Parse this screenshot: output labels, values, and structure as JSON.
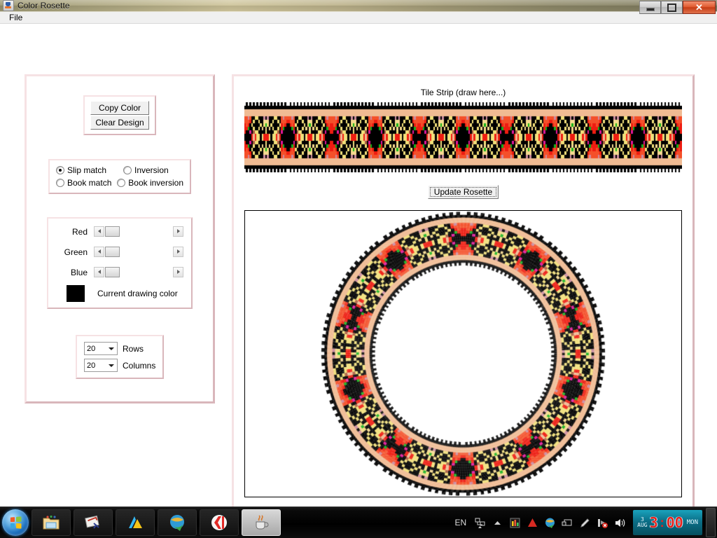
{
  "window": {
    "title": "Color Rosette",
    "icon": "java-coffee-cup-icon",
    "buttons": {
      "minimize": "–",
      "maximize": "❐",
      "close": "✕"
    }
  },
  "menubar": {
    "items": [
      {
        "label": "File"
      }
    ]
  },
  "left_panel": {
    "buttons": [
      {
        "label": "Copy Color",
        "name": "copy-color-button"
      },
      {
        "label": "Clear Design",
        "name": "clear-design-button"
      }
    ],
    "match_modes": [
      {
        "label": "Slip match",
        "selected": true
      },
      {
        "label": "Inversion",
        "selected": false
      },
      {
        "label": "Book match",
        "selected": false
      },
      {
        "label": "Book inversion",
        "selected": false
      }
    ],
    "color_sliders": [
      {
        "label": "Red",
        "value": 0
      },
      {
        "label": "Green",
        "value": 0
      },
      {
        "label": "Blue",
        "value": 0
      }
    ],
    "current_color": {
      "label": "Current drawing color",
      "hex": "#000000"
    },
    "grid": [
      {
        "value": "20",
        "label": "Rows"
      },
      {
        "value": "20",
        "label": "Columns"
      }
    ]
  },
  "right_panel": {
    "strip_title": "Tile Strip (draw here...)",
    "update_button": "Update Rosette"
  },
  "artwork": {
    "palette": {
      "black": "#000000",
      "red": "#ee1c11",
      "orange_red": "#f4502a",
      "yellow": "#f2e07a",
      "cream": "#f5d98f",
      "peach": "#f0bb93",
      "brown": "#a85c40",
      "pink": "#cc8ca0",
      "magenta": "#e0189a",
      "green": "#13b11d",
      "white": "#ffffff"
    },
    "rows": 20,
    "columns": 20,
    "strip_repeats": 5
  },
  "taskbar": {
    "start": "windows-start-orb",
    "items": [
      {
        "name": "taskbar-item-explorer",
        "icon": "folder-icon",
        "active": false
      },
      {
        "name": "taskbar-item-app2",
        "icon": "package-icon",
        "active": false
      },
      {
        "name": "taskbar-item-aimp",
        "icon": "triangle-icon",
        "active": false
      },
      {
        "name": "taskbar-item-idm",
        "icon": "globe-arrow-icon",
        "active": false
      },
      {
        "name": "taskbar-item-yandex",
        "icon": "yandex-icon",
        "active": false
      },
      {
        "name": "taskbar-item-java",
        "icon": "java-coffee-cup-icon",
        "active": true
      }
    ],
    "tray": {
      "language": "EN",
      "icons": [
        "network-icon",
        "chevron-up-icon",
        "equalizer-icon",
        "aimp-icon",
        "idm-icon",
        "monitor-icon",
        "pen-icon",
        "network-error-icon",
        "volume-icon"
      ]
    },
    "clock": {
      "month": "AUG",
      "day_number": "3",
      "hour": "3",
      "minute": "00",
      "weekday": "MON",
      "separator": ":"
    }
  }
}
